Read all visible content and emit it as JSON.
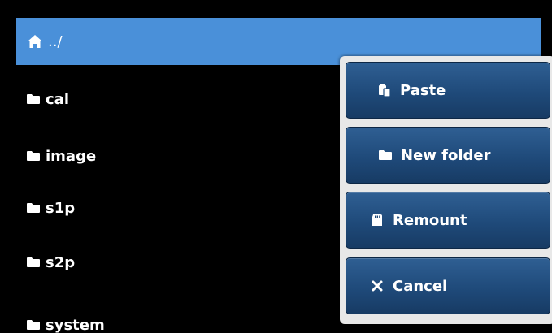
{
  "path_bar": {
    "icon": "home-icon",
    "label": "../",
    "color": "#4a90d9"
  },
  "files": [
    {
      "name": "cal",
      "icon": "folder-icon"
    },
    {
      "name": "image",
      "icon": "folder-icon"
    },
    {
      "name": "s1p",
      "icon": "folder-icon"
    },
    {
      "name": "s2p",
      "icon": "folder-icon"
    },
    {
      "name": "system",
      "icon": "folder-icon"
    }
  ],
  "menu": {
    "items": [
      {
        "label": "Paste",
        "icon": "paste-icon"
      },
      {
        "label": "New folder",
        "icon": "folder-icon"
      },
      {
        "label": "Remount",
        "icon": "sd-card-icon"
      },
      {
        "label": "Cancel",
        "icon": "close-icon"
      }
    ],
    "button_color": "#1f4a7a"
  }
}
